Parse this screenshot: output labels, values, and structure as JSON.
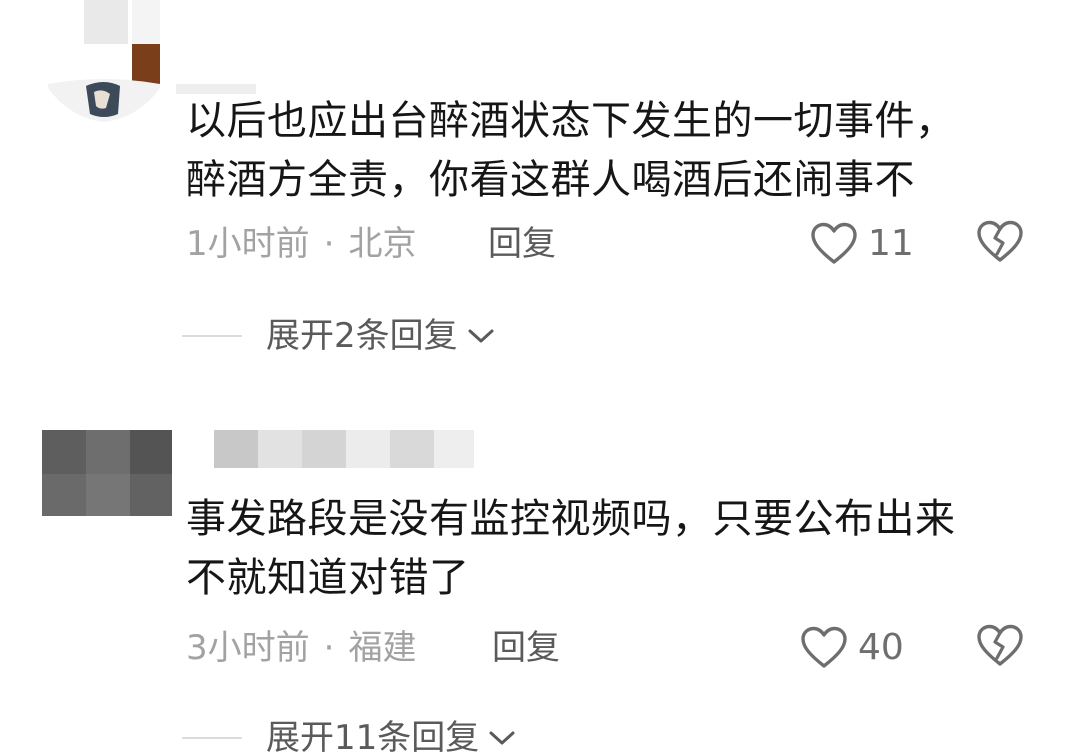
{
  "comments": [
    {
      "text_line1": "以后也应出台醉酒状态下发生的一切事件，",
      "text_line2": "醉酒方全责，你看这群人喝酒后还闹事不",
      "time": "1小时前",
      "separator": "·",
      "location": "北京",
      "reply_label": "回复",
      "like_count": "11",
      "expand_label": "展开2条回复"
    },
    {
      "text_line1": "事发路段是没有监控视频吗，只要公布出来",
      "text_line2": "不就知道对错了",
      "time": "3小时前",
      "separator": "·",
      "location": "福建",
      "reply_label": "回复",
      "like_count": "40",
      "expand_label": "展开11条回复"
    }
  ],
  "icons": {
    "like": "heart-outline-icon",
    "dislike": "broken-heart-icon",
    "expand": "chevron-down-icon"
  },
  "colors": {
    "text": "#161616",
    "meta": "#a2a2a2",
    "action": "#5a5a5a",
    "icon": "#6e6e6e"
  }
}
